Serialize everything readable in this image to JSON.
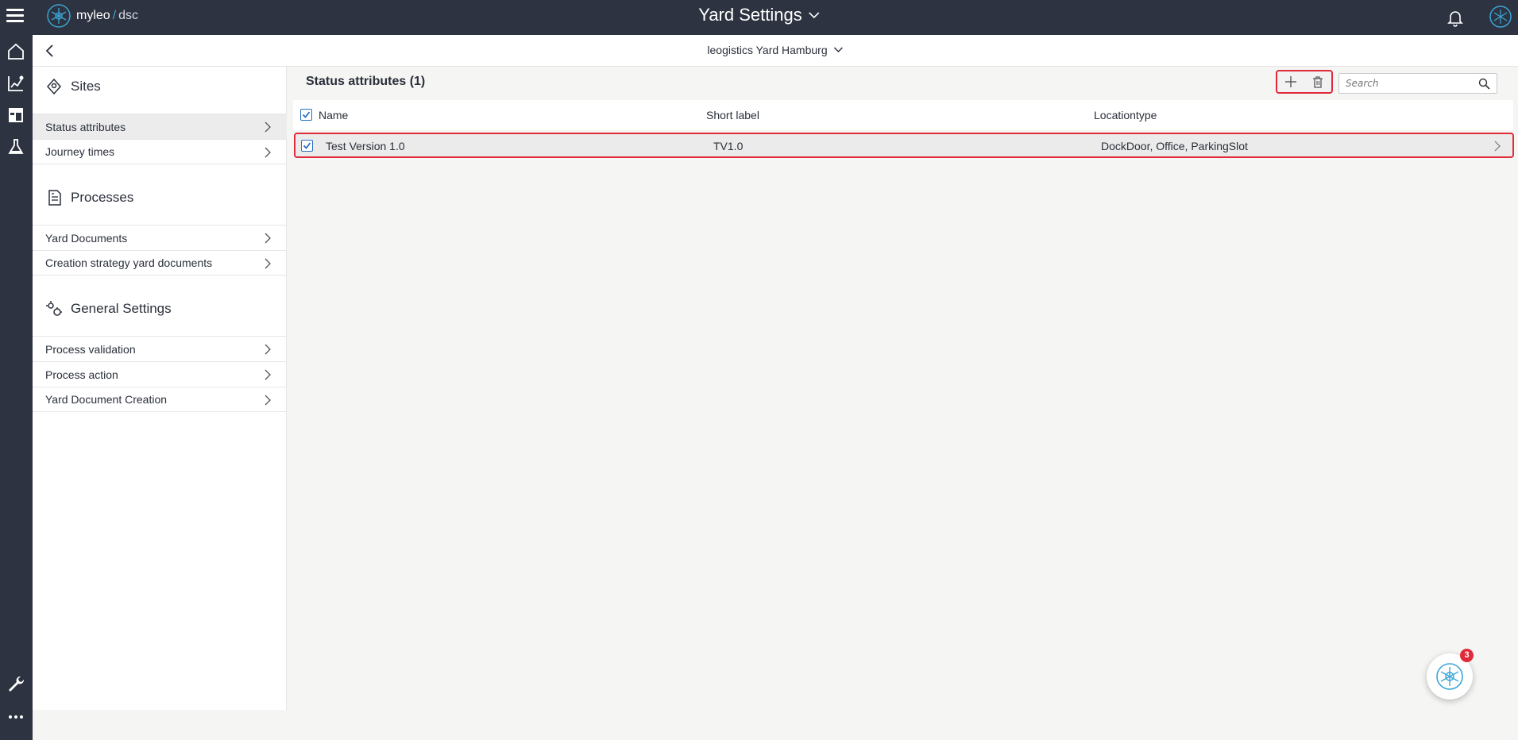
{
  "app": {
    "logo_name": "myleo",
    "logo_sep": "/",
    "logo_suffix": "dsc",
    "title": "Yard Settings"
  },
  "subheader": {
    "site": "leogistics Yard Hamburg"
  },
  "sidebar": {
    "sections": [
      {
        "title": "Sites",
        "icon": "location-diamond-icon"
      },
      {
        "title": "Processes",
        "icon": "document-list-icon"
      },
      {
        "title": "General Settings",
        "icon": "gears-icon"
      }
    ],
    "items": [
      {
        "label": "Status attributes",
        "active": true
      },
      {
        "label": "Journey times"
      },
      {
        "label": "Yard Documents"
      },
      {
        "label": "Creation strategy yard documents"
      },
      {
        "label": "Process validation"
      },
      {
        "label": "Process action"
      },
      {
        "label": "Yard Document Creation"
      }
    ]
  },
  "main": {
    "title": "Status attributes (1)",
    "search": {
      "placeholder": "Search",
      "value": ""
    },
    "table": {
      "columns": [
        "Name",
        "Short label",
        "Locationtype"
      ],
      "rows": [
        {
          "name": "Test Version 1.0",
          "short_label": "TV1.0",
          "location_type": "DockDoor, Office, ParkingSlot",
          "checked": true
        }
      ]
    }
  },
  "fab": {
    "badge": "3"
  },
  "colors": {
    "topbar": "#2d3340",
    "accent": "#3aa6d6",
    "highlight": "#e02a3a",
    "checkbox": "#2a6fc4"
  }
}
